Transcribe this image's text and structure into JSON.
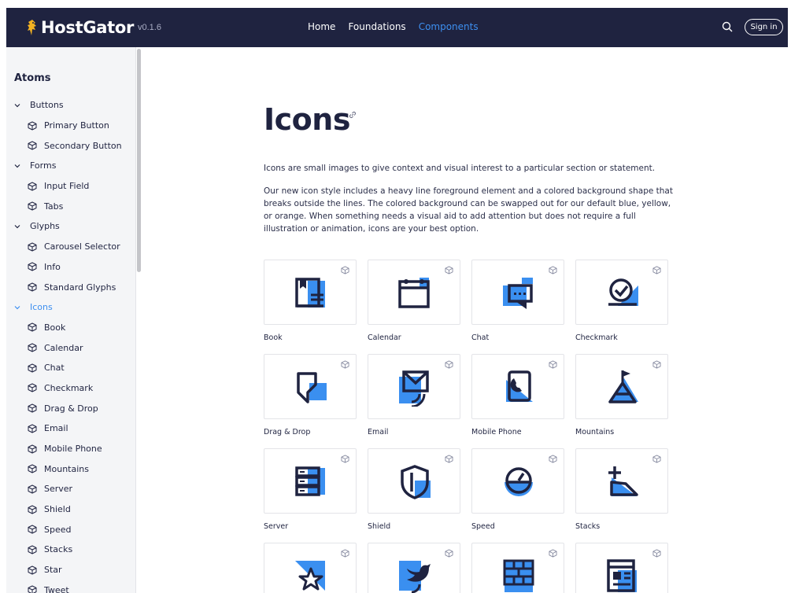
{
  "header": {
    "logo_text": "HostGator",
    "version": "v0.1.6",
    "nav": [
      {
        "label": "Home",
        "active": false
      },
      {
        "label": "Foundations",
        "active": false
      },
      {
        "label": "Components",
        "active": true
      }
    ],
    "search_icon": "search-icon",
    "signin_label": "Sign in"
  },
  "sidebar": {
    "title": "Atoms",
    "items": [
      {
        "label": "Buttons",
        "type": "group",
        "active": false
      },
      {
        "label": "Primary Button",
        "type": "child"
      },
      {
        "label": "Secondary Button",
        "type": "child"
      },
      {
        "label": "Forms",
        "type": "group",
        "active": false
      },
      {
        "label": "Input Field",
        "type": "child"
      },
      {
        "label": "Tabs",
        "type": "child"
      },
      {
        "label": "Glyphs",
        "type": "group",
        "active": false
      },
      {
        "label": "Carousel Selector",
        "type": "child"
      },
      {
        "label": "Info",
        "type": "child"
      },
      {
        "label": "Standard Glyphs",
        "type": "child"
      },
      {
        "label": "Icons",
        "type": "group",
        "active": true
      },
      {
        "label": "Book",
        "type": "child"
      },
      {
        "label": "Calendar",
        "type": "child"
      },
      {
        "label": "Chat",
        "type": "child"
      },
      {
        "label": "Checkmark",
        "type": "child"
      },
      {
        "label": "Drag & Drop",
        "type": "child"
      },
      {
        "label": "Email",
        "type": "child"
      },
      {
        "label": "Mobile Phone",
        "type": "child"
      },
      {
        "label": "Mountains",
        "type": "child"
      },
      {
        "label": "Server",
        "type": "child"
      },
      {
        "label": "Shield",
        "type": "child"
      },
      {
        "label": "Speed",
        "type": "child"
      },
      {
        "label": "Stacks",
        "type": "child"
      },
      {
        "label": "Star",
        "type": "child"
      },
      {
        "label": "Tweet",
        "type": "child"
      }
    ]
  },
  "main": {
    "title": "Icons",
    "intro": "Icons are small images to give context and visual interest to a particular section or statement.",
    "description": "Our new icon style includes a heavy line foreground element and a colored background shape that breaks outside the lines. The colored background can be swapped out for our default blue, yellow, or orange. When something needs a visual aid to add attention but does not require a full illustration or animation, icons are your best option.",
    "icons": [
      {
        "label": "Book",
        "icon": "book-icon"
      },
      {
        "label": "Calendar",
        "icon": "calendar-icon"
      },
      {
        "label": "Chat",
        "icon": "chat-icon"
      },
      {
        "label": "Checkmark",
        "icon": "checkmark-icon"
      },
      {
        "label": "Drag & Drop",
        "icon": "drag-drop-icon"
      },
      {
        "label": "Email",
        "icon": "email-icon"
      },
      {
        "label": "Mobile Phone",
        "icon": "mobile-phone-icon"
      },
      {
        "label": "Mountains",
        "icon": "mountains-icon"
      },
      {
        "label": "Server",
        "icon": "server-icon"
      },
      {
        "label": "Shield",
        "icon": "shield-icon"
      },
      {
        "label": "Speed",
        "icon": "speed-icon"
      },
      {
        "label": "Stacks",
        "icon": "stacks-icon"
      },
      {
        "label": "",
        "icon": "star-icon"
      },
      {
        "label": "",
        "icon": "tweet-icon"
      },
      {
        "label": "",
        "icon": "firewall-icon"
      },
      {
        "label": "",
        "icon": "website-icon"
      }
    ]
  },
  "colors": {
    "header_bg": "#1f2340",
    "accent": "#3d8ff0",
    "icon_blue": "#3a8ff0",
    "icon_navy": "#1f2340",
    "sidebar_bg": "#f4f5f7"
  }
}
